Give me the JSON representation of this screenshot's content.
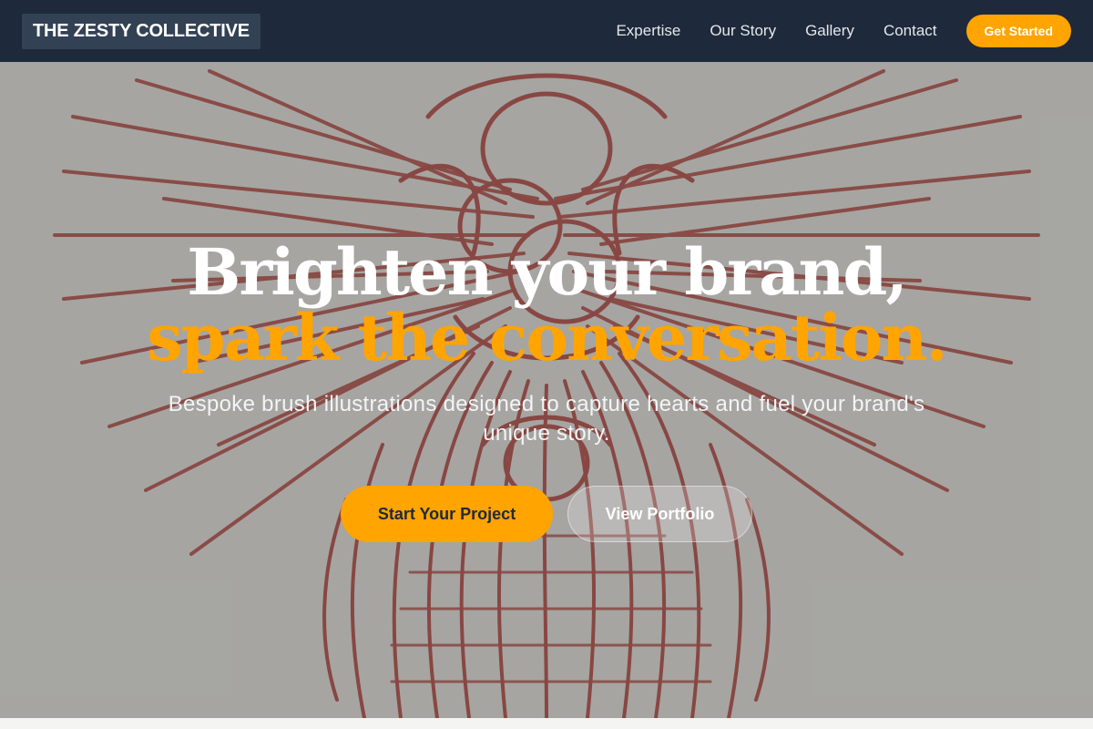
{
  "header": {
    "logo": "THE ZESTY COLLECTIVE",
    "nav": [
      "Expertise",
      "Our Story",
      "Gallery",
      "Contact"
    ],
    "cta": "Get Started"
  },
  "hero": {
    "headline_line1": "Brighten your brand,",
    "headline_line2": "spark the conversation.",
    "subtitle": "Bespoke brush illustrations designed to capture hearts and fuel your brand's unique story.",
    "primary_button": "Start Your Project",
    "secondary_button": "View Portfolio",
    "background_image": "red-line-engraving-winged-figures"
  },
  "colors": {
    "header_bg": "#1e293b",
    "logo_bg": "#334155",
    "accent": "#ffa400",
    "illustration_red": "#c0504c",
    "headline_white": "#ffffff"
  }
}
